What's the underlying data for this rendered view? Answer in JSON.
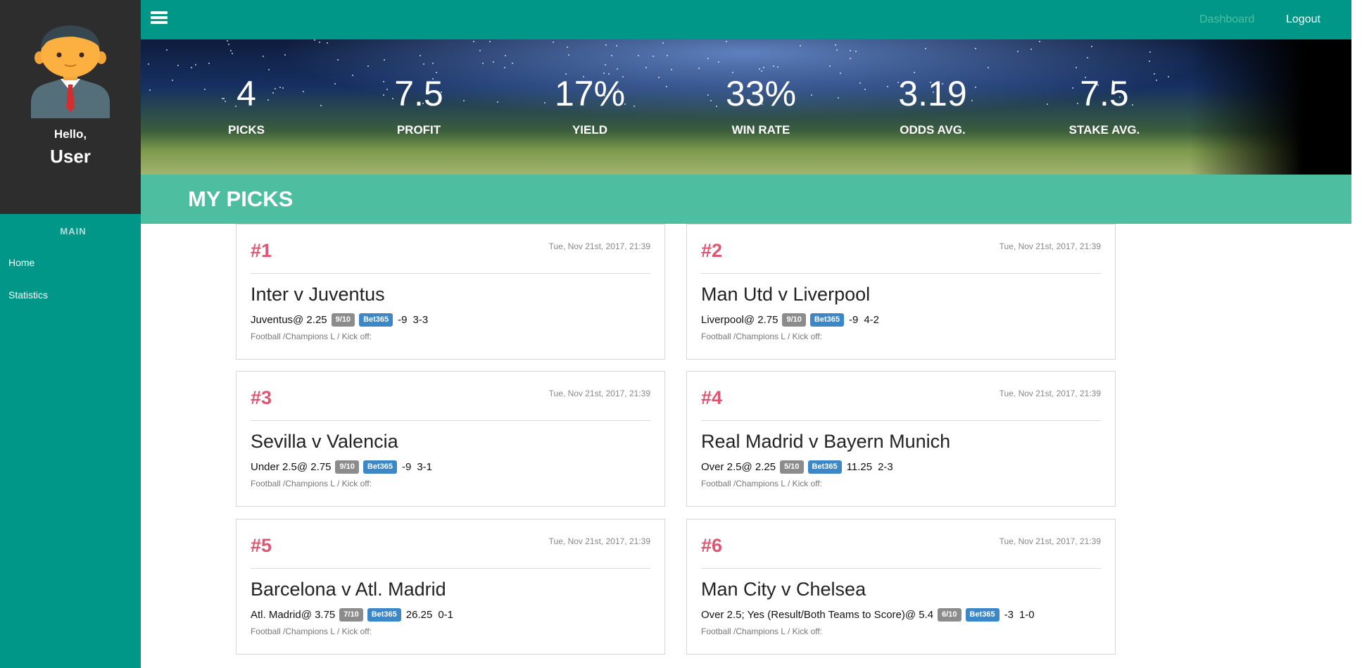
{
  "user": {
    "greeting": "Hello,",
    "name": "User"
  },
  "sidebar": {
    "section_title": "MAIN",
    "items": [
      {
        "label": "Home"
      },
      {
        "label": "Statistics"
      }
    ]
  },
  "topbar": {
    "links": [
      {
        "label": "Dashboard",
        "color": "#4dbfa0"
      },
      {
        "label": "Logout",
        "color": "#ffffff"
      }
    ]
  },
  "stats": [
    {
      "value": "4",
      "label": "Picks"
    },
    {
      "value": "7.5",
      "label": "Profit"
    },
    {
      "value": "17%",
      "label": "Yield"
    },
    {
      "value": "33%",
      "label": "Win rate"
    },
    {
      "value": "3.19",
      "label": "Odds avg."
    },
    {
      "value": "7.5",
      "label": "Stake avg."
    }
  ],
  "picks_title": "MY PICKS",
  "picks": [
    {
      "number": "#1",
      "date": "Tue, Nov 21st, 2017, 21:39",
      "match": "Inter v Juventus",
      "selection": "Juventus@ 2.25",
      "stake": "9/10",
      "bookmaker": "Bet365",
      "profit": "-9",
      "score": "3-3",
      "meta": "Football /Champions L / Kick off:"
    },
    {
      "number": "#2",
      "date": "Tue, Nov 21st, 2017, 21:39",
      "match": "Man Utd v Liverpool",
      "selection": "Liverpool@ 2.75",
      "stake": "9/10",
      "bookmaker": "Bet365",
      "profit": "-9",
      "score": "4-2",
      "meta": "Football /Champions L / Kick off:"
    },
    {
      "number": "#3",
      "date": "Tue, Nov 21st, 2017, 21:39",
      "match": "Sevilla v Valencia",
      "selection": "Under 2.5@ 2.75",
      "stake": "9/10",
      "bookmaker": "Bet365",
      "profit": "-9",
      "score": "3-1",
      "meta": "Football /Champions L / Kick off:"
    },
    {
      "number": "#4",
      "date": "Tue, Nov 21st, 2017, 21:39",
      "match": "Real Madrid v Bayern Munich",
      "selection": "Over 2.5@ 2.25",
      "stake": "5/10",
      "bookmaker": "Bet365",
      "profit": "11.25",
      "score": "2-3",
      "meta": "Football /Champions L / Kick off:"
    },
    {
      "number": "#5",
      "date": "Tue, Nov 21st, 2017, 21:39",
      "match": "Barcelona v Atl. Madrid",
      "selection": "Atl. Madrid@ 3.75",
      "stake": "7/10",
      "bookmaker": "Bet365",
      "profit": "26.25",
      "score": "0-1",
      "meta": "Football /Champions L / Kick off:"
    },
    {
      "number": "#6",
      "date": "Tue, Nov 21st, 2017, 21:39",
      "match": "Man City v Chelsea",
      "selection": "Over 2.5; Yes (Result/Both Teams to Score)@ 5.4",
      "stake": "6/10",
      "bookmaker": "Bet365",
      "profit": "-3",
      "score": "1-0",
      "meta": "Football /Champions L / Kick off:"
    }
  ]
}
